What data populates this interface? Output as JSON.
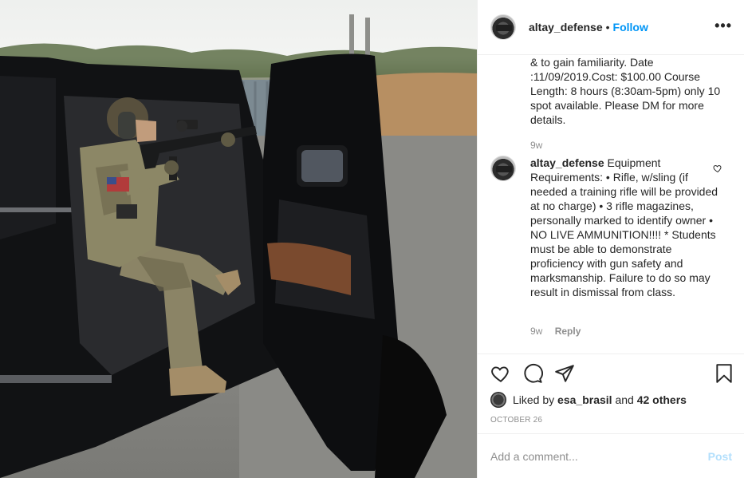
{
  "post": {
    "author": "altay_defense",
    "follow_label": "Follow",
    "separator": "•",
    "more_label": "•••"
  },
  "comments": [
    {
      "text": "& to gain familiarity. Date :11/09/2019.Cost: $100.00 Course Length: 8 hours (8:30am-5pm) only 10 spot available. Please DM for more details.",
      "time": "9w"
    },
    {
      "user": "altay_defense",
      "text": "Equipment Requirements: • Rifle, w/sling (if needed a training rifle will be provided at no charge) • 3 rifle magazines, personally marked to identify owner • NO LIVE AMMUNITION!!!! * Students must be able to demonstrate proficiency with gun safety and marksmanship. Failure to do so may result in dismissal from class.",
      "time": "9w",
      "reply_label": "Reply"
    }
  ],
  "likes": {
    "prefix": "Liked by",
    "user": "esa_brasil",
    "connector": "and",
    "others": "42 others"
  },
  "date": "OCTOBER 26",
  "add_comment": {
    "placeholder": "Add a comment...",
    "post_label": "Post"
  },
  "colors": {
    "accent": "#0095f6",
    "post_disabled": "#b2dffc",
    "muted": "#8e8e8e",
    "text": "#262626"
  },
  "icons": [
    "heart-icon",
    "comment-icon",
    "share-icon",
    "bookmark-icon",
    "more-icon"
  ]
}
